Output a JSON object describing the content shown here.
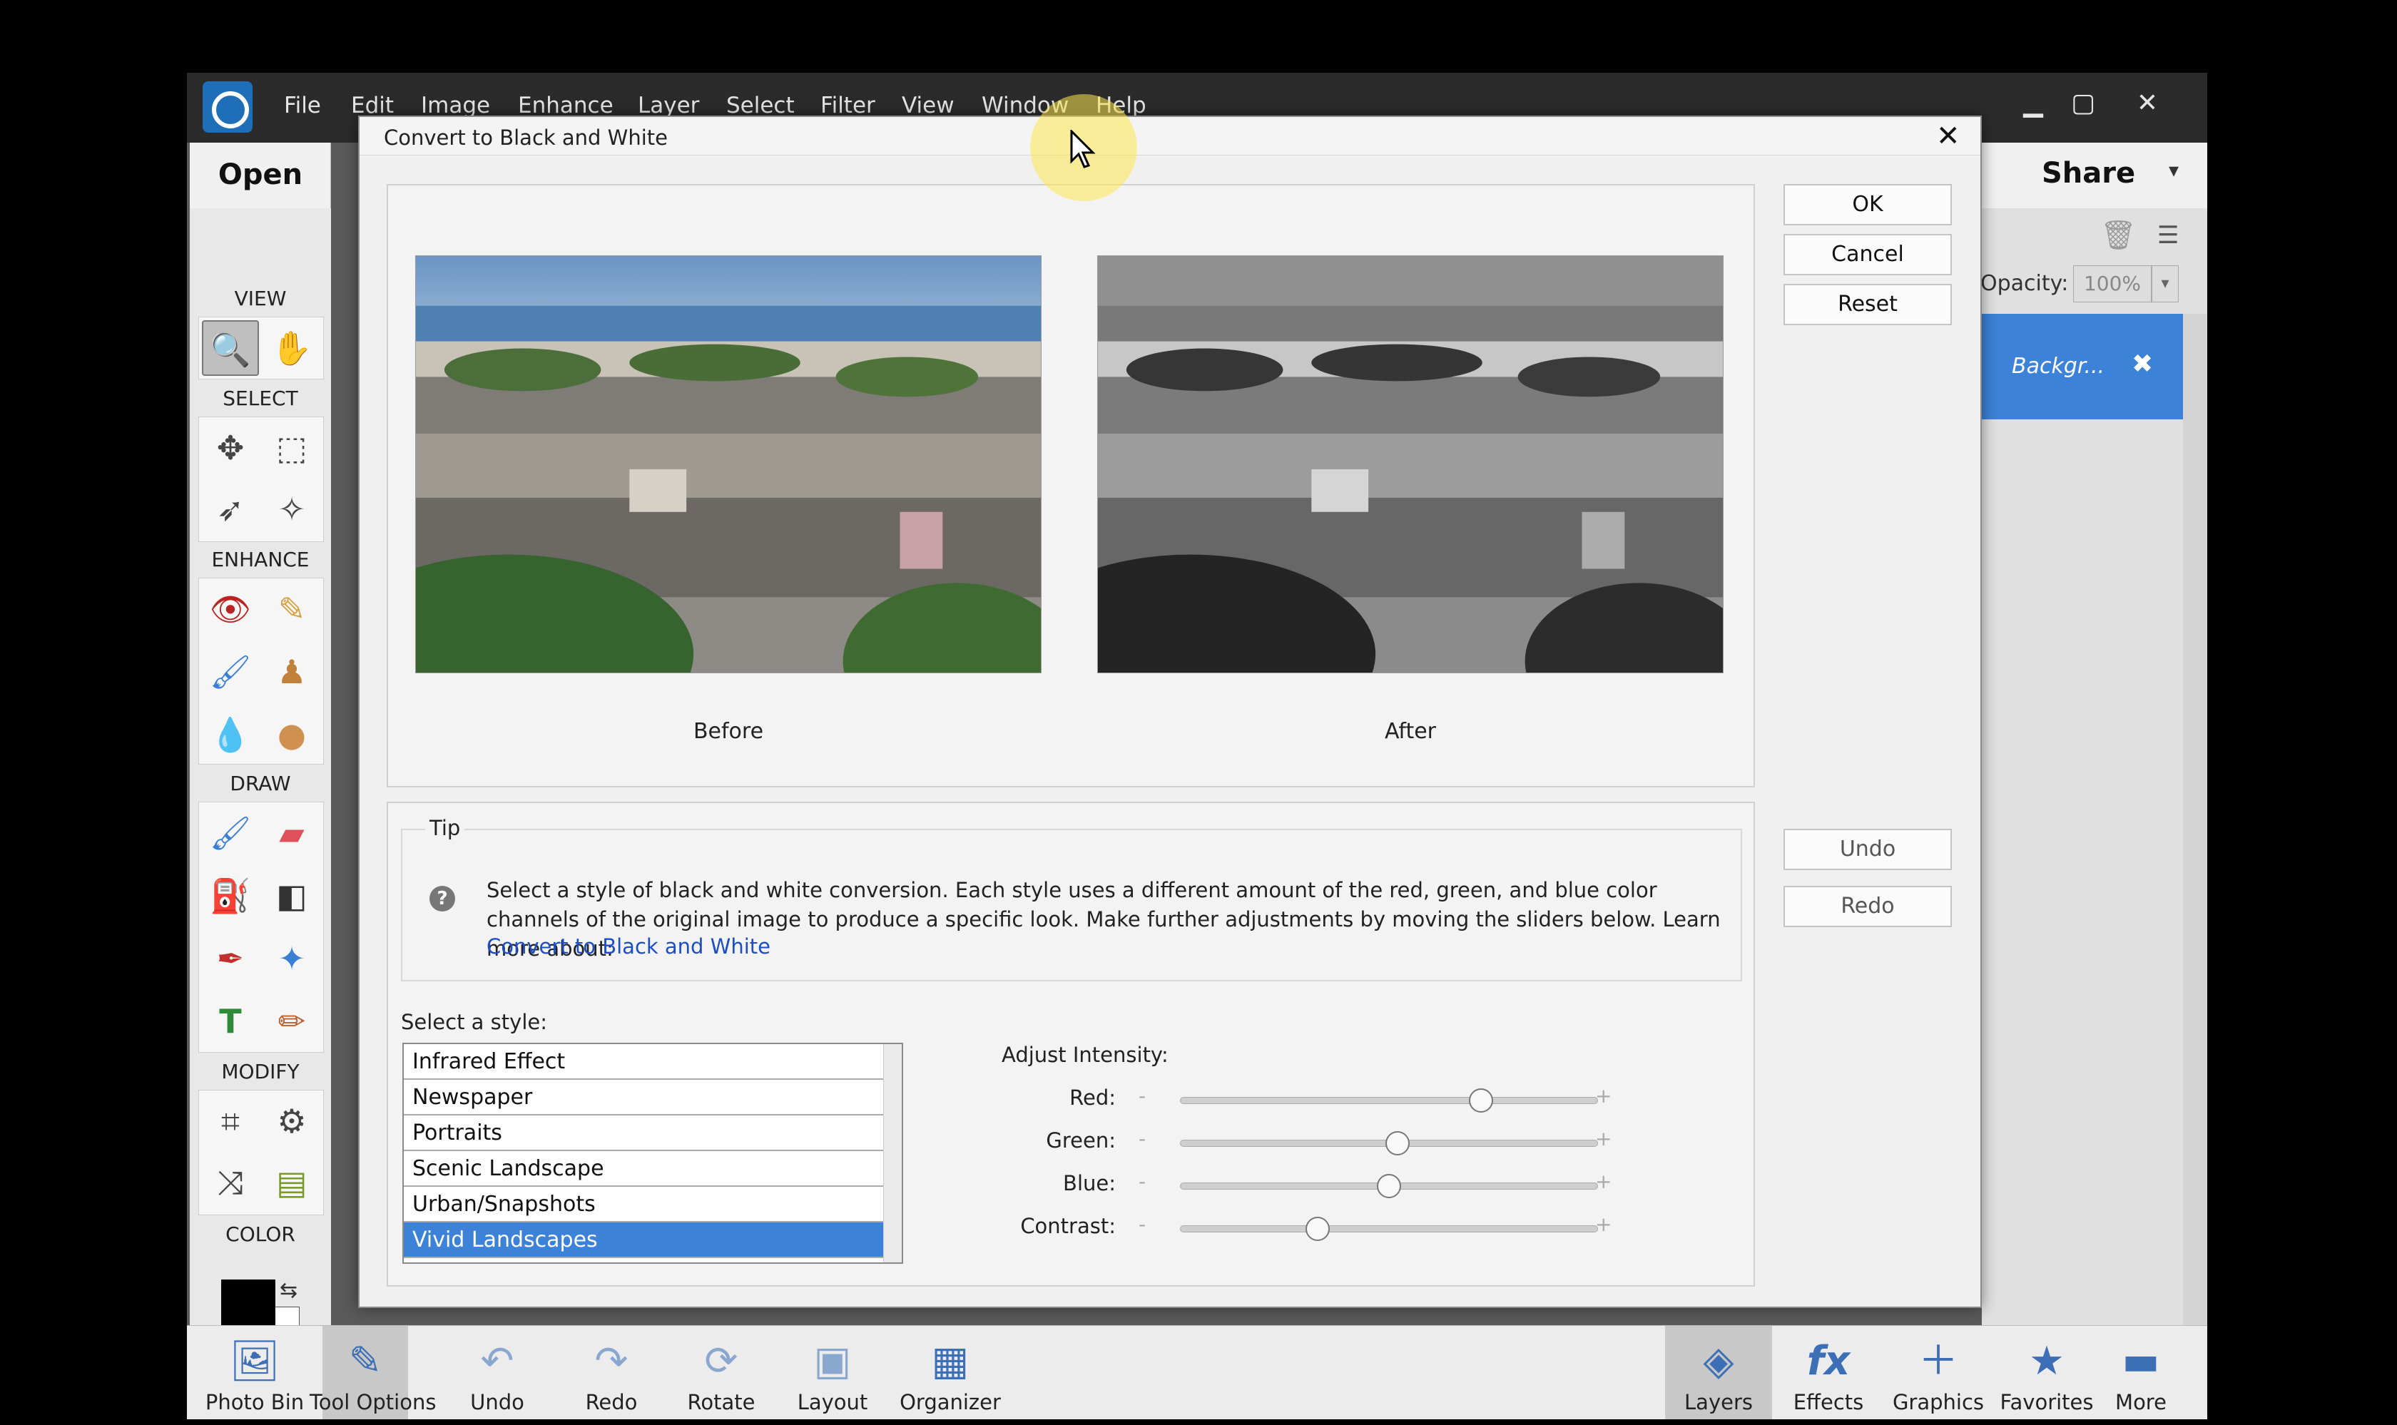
{
  "menu": [
    "File",
    "Edit",
    "Image",
    "Enhance",
    "Layer",
    "Select",
    "Filter",
    "View",
    "Window",
    "Help"
  ],
  "window_controls": {
    "minimize": "▁",
    "maximize": "▢",
    "close": "✕"
  },
  "top": {
    "open_label": "Open",
    "share_label": "Share"
  },
  "toolbox": {
    "view_label": "VIEW",
    "select_label": "SELECT",
    "enhance_label": "ENHANCE",
    "draw_label": "DRAW",
    "modify_label": "MODIFY",
    "color_label": "COLOR"
  },
  "layers_panel": {
    "opacity_label": "Opacity:",
    "opacity_value": "100%",
    "layer_name": "Backgr..."
  },
  "dialog": {
    "title": "Convert to Black and White",
    "ok_label": "OK",
    "cancel_label": "Cancel",
    "reset_label": "Reset",
    "undo_label": "Undo",
    "redo_label": "Redo",
    "before_caption": "Before",
    "after_caption": "After",
    "tip_title": "Tip",
    "tip_text": "Select a style of black and white conversion. Each style uses a different amount of the red, green, and blue color channels of the original image to produce a specific look. Make further adjustments by moving the sliders below. Learn more about:",
    "tip_link": "Convert to Black and White",
    "style_label": "Select a style:",
    "styles": [
      "Infrared Effect",
      "Newspaper",
      "Portraits",
      "Scenic Landscape",
      "Urban/Snapshots",
      "Vivid Landscapes"
    ],
    "selected_style": "Vivid Landscapes",
    "adjust_label": "Adjust Intensity:",
    "sliders": [
      {
        "label": "Red:",
        "value": 0.72
      },
      {
        "label": "Green:",
        "value": 0.52
      },
      {
        "label": "Blue:",
        "value": 0.5
      },
      {
        "label": "Contrast:",
        "value": 0.33
      }
    ],
    "minus": "-",
    "plus": "+"
  },
  "bottombar": [
    "Photo Bin",
    "Tool Options",
    "Undo",
    "Redo",
    "Rotate",
    "Layout",
    "Organizer",
    "Layers",
    "Effects",
    "Graphics",
    "Favorites",
    "More"
  ]
}
